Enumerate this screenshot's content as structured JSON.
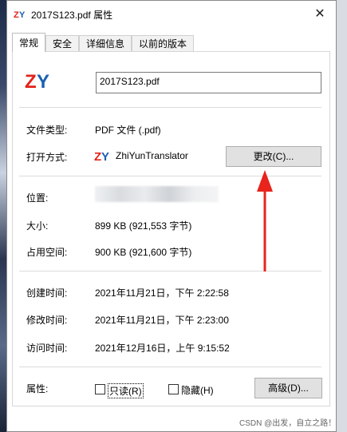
{
  "window": {
    "title": "2017S123.pdf 属性",
    "close_glyph": "✕"
  },
  "tabs": [
    {
      "label": "常规",
      "active": true
    },
    {
      "label": "安全",
      "active": false
    },
    {
      "label": "详细信息",
      "active": false
    },
    {
      "label": "以前的版本",
      "active": false
    }
  ],
  "file": {
    "name": "2017S123.pdf",
    "icon": "zy-app-icon",
    "icon_text": "ZY"
  },
  "type": {
    "label": "文件类型:",
    "value": "PDF 文件 (.pdf)"
  },
  "open_with": {
    "label": "打开方式:",
    "app": "ZhiYunTranslator",
    "icon": "zy-app-icon",
    "icon_text": "ZY",
    "change_button": "更改(C)..."
  },
  "location": {
    "label": "位置:"
  },
  "size": {
    "label": "大小:",
    "value": "899 KB (921,553 字节)"
  },
  "size_on_disk": {
    "label": "占用空间:",
    "value": "900 KB (921,600 字节)"
  },
  "created": {
    "label": "创建时间:",
    "value": "2021年11月21日，下午 2:22:58"
  },
  "modified": {
    "label": "修改时间:",
    "value": "2021年11月21日，下午 2:23:00"
  },
  "accessed": {
    "label": "访问时间:",
    "value": "2021年12月16日，上午 9:15:52"
  },
  "attributes": {
    "label": "属性:",
    "readonly_label": "只读(R)",
    "readonly_checked": false,
    "hidden_label": "隐藏(H)",
    "hidden_checked": false,
    "advanced_button": "高级(D)..."
  },
  "annotation": {
    "icon": "red-arrow-pointing-to-change-button",
    "color": "#e8241c"
  },
  "watermark": "CSDN @出发，自立之路！",
  "colors": {
    "logo_red": "#e2231a",
    "logo_blue": "#1a5fb4"
  }
}
